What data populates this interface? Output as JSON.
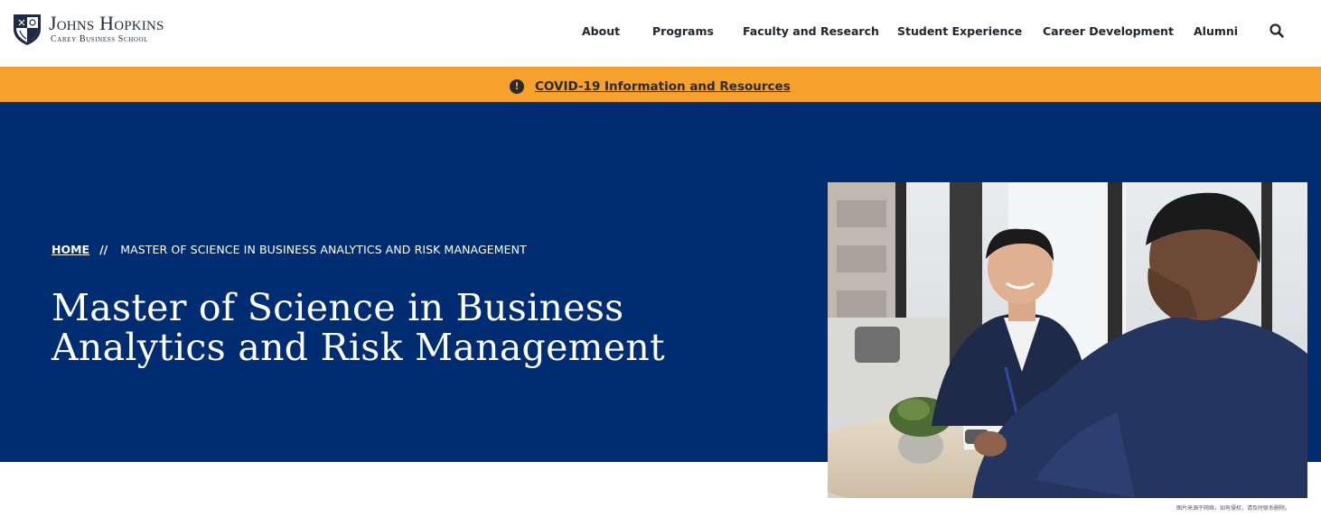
{
  "header": {
    "logo": {
      "name": "Johns Hopkins",
      "subtitle": "Carey Business School"
    },
    "nav": [
      {
        "label": "About"
      },
      {
        "label": "Programs"
      },
      {
        "label": "Faculty and Research"
      },
      {
        "label": "Student Experience"
      },
      {
        "label": "Career Development"
      },
      {
        "label": "Alumni"
      }
    ],
    "search_icon": "search-icon"
  },
  "alert": {
    "icon": "exclamation-icon",
    "link_text": "COVID-19 Information and Resources"
  },
  "hero": {
    "breadcrumb": {
      "home": "HOME",
      "separator": "//",
      "current": "MASTER OF SCIENCE IN BUSINESS ANALYTICS AND RISK MANAGEMENT"
    },
    "title": "Master of Science in Business Analytics and Risk Management"
  },
  "image_caption": "图片来源于网络，如有侵权，请及时联系删除。",
  "colors": {
    "brand_navy": "#002d72",
    "alert_orange": "#f5a12b",
    "header_bg": "#ffffff"
  }
}
